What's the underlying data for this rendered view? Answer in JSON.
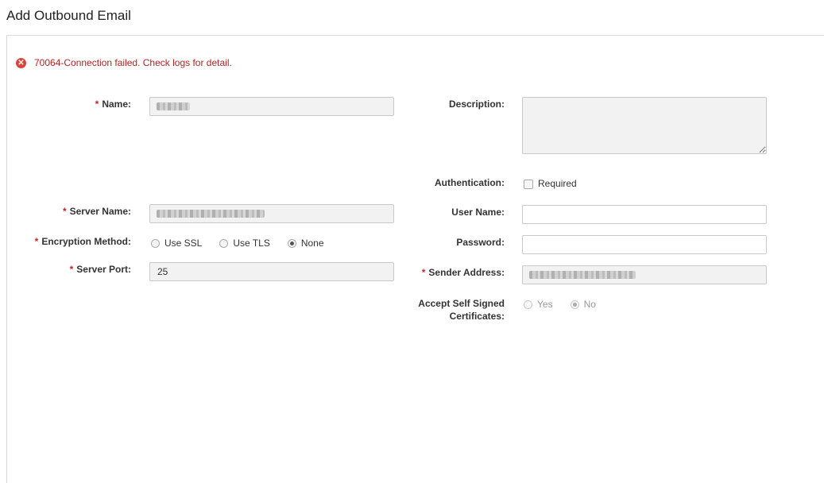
{
  "page": {
    "title": "Add Outbound Email"
  },
  "error": {
    "message": "70064-Connection failed. Check logs for detail."
  },
  "form": {
    "name": {
      "label": "Name:",
      "required_mark": "*"
    },
    "description": {
      "label": "Description:",
      "value": ""
    },
    "authentication": {
      "label": "Authentication:",
      "checkbox_label": "Required",
      "checked": false
    },
    "server_name": {
      "label": "Server Name:",
      "required_mark": "*"
    },
    "user_name": {
      "label": "User Name:",
      "value": ""
    },
    "encryption": {
      "label": "Encryption Method:",
      "required_mark": "*",
      "options": [
        "Use SSL",
        "Use TLS",
        "None"
      ],
      "selected": "None"
    },
    "password": {
      "label": "Password:",
      "value": ""
    },
    "server_port": {
      "label": "Server Port:",
      "required_mark": "*",
      "value": "25"
    },
    "sender_address": {
      "label": "Sender Address:",
      "required_mark": "*"
    },
    "self_signed": {
      "label_line1": "Accept Self Signed",
      "label_line2": "Certificates:",
      "options": [
        "Yes",
        "No"
      ],
      "selected": "No",
      "disabled": true
    }
  },
  "colors": {
    "error": "#b22222",
    "required": "#c0282d",
    "error_icon": "#d9453b"
  }
}
